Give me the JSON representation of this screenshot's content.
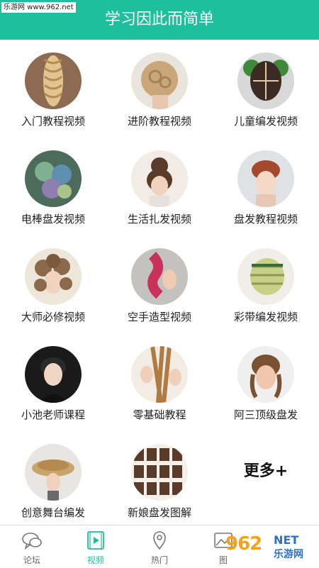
{
  "watermark": "乐游网 www.962.net",
  "header": {
    "title": "学习因此而简单"
  },
  "grid": {
    "items": [
      {
        "label": "入门教程视频",
        "icon": "braid-tutorial-thumbnail"
      },
      {
        "label": "进阶教程视频",
        "icon": "advanced-updo-thumbnail"
      },
      {
        "label": "儿童编发视频",
        "icon": "kids-braid-thumbnail"
      },
      {
        "label": "电棒盘发视频",
        "icon": "curling-iron-thumbnail"
      },
      {
        "label": "生活扎发视频",
        "icon": "everyday-bun-thumbnail"
      },
      {
        "label": "盘发教程视频",
        "icon": "updo-tutorial-thumbnail"
      },
      {
        "label": "大师必修视频",
        "icon": "master-curls-thumbnail"
      },
      {
        "label": "空手造型视频",
        "icon": "hand-styling-thumbnail"
      },
      {
        "label": "彩带编发视频",
        "icon": "ribbon-braid-thumbnail"
      },
      {
        "label": "小池老师课程",
        "icon": "teacher-portrait-thumbnail"
      },
      {
        "label": "零基础教程",
        "icon": "beginner-braid-thumbnail"
      },
      {
        "label": "阿三顶级盘发",
        "icon": "mannequin-updo-thumbnail"
      },
      {
        "label": "创意舞台编发",
        "icon": "stage-braid-thumbnail"
      },
      {
        "label": "新娘盘发图解",
        "icon": "bridal-diagram-thumbnail"
      }
    ],
    "more_label": "更多+"
  },
  "tabbar": {
    "tabs": [
      {
        "label": "论坛",
        "icon": "chat-bubble-icon",
        "active": false
      },
      {
        "label": "视频",
        "icon": "video-icon",
        "active": true
      },
      {
        "label": "热门",
        "icon": "location-pin-icon",
        "active": false
      },
      {
        "label": "图",
        "icon": "image-icon",
        "active": false
      }
    ]
  },
  "brand": {
    "number": "962",
    "net": "NET",
    "cn": "乐游网"
  },
  "colors": {
    "accent": "#1dbf9c",
    "text": "#222222",
    "brand_orange": "#f5a21b",
    "brand_blue": "#2b6fd1"
  }
}
